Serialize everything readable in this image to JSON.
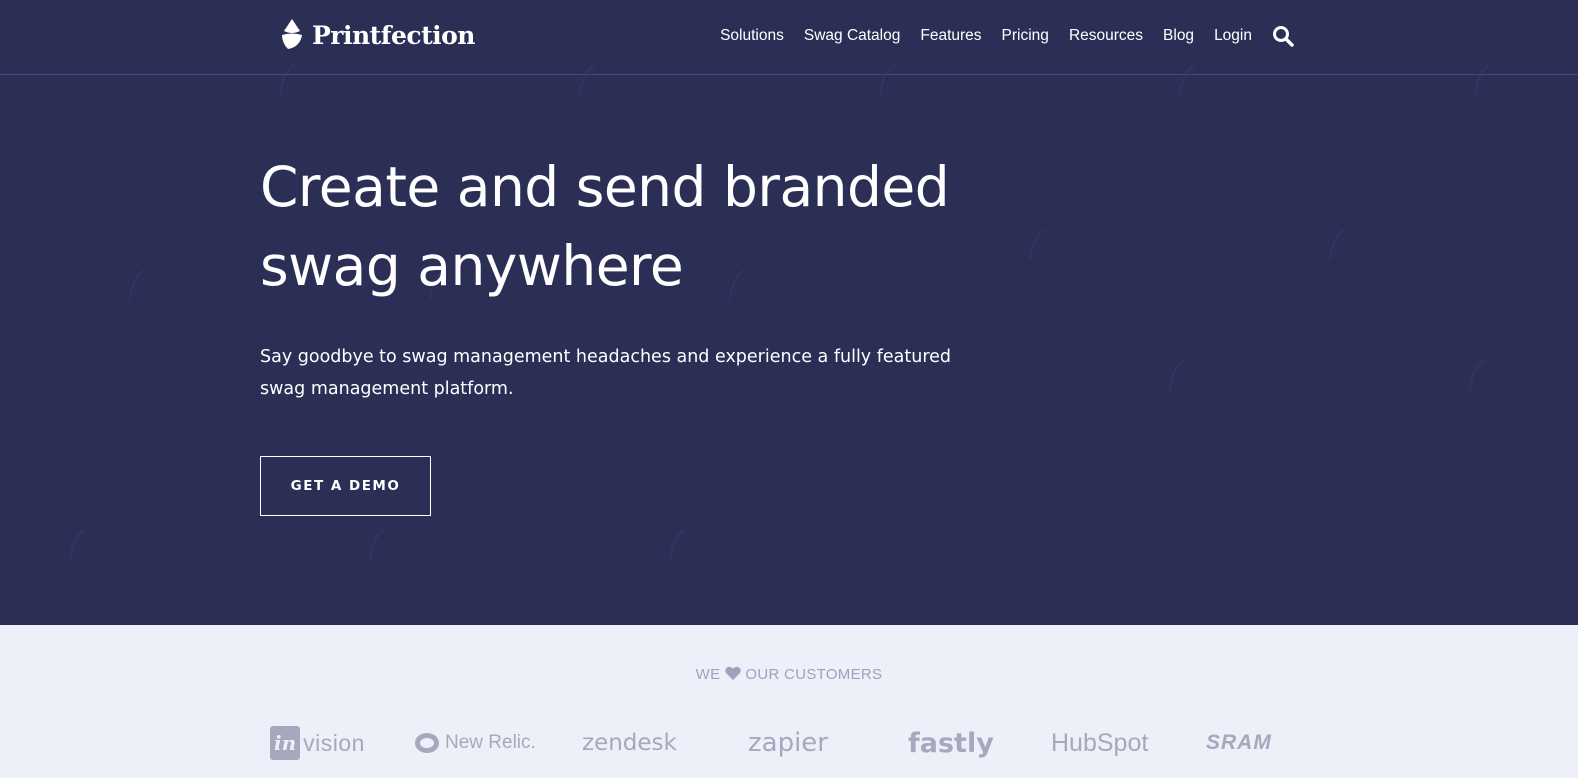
{
  "brand": {
    "name": "Printfection"
  },
  "nav": {
    "items": [
      "Solutions",
      "Swag Catalog",
      "Features",
      "Pricing",
      "Resources",
      "Blog",
      "Login"
    ],
    "search_icon": "search-icon"
  },
  "hero": {
    "headline_line1": "Create and send branded",
    "headline_line2": "swag anywhere",
    "subtext": "Say goodbye to swag management headaches and experience a fully featured swag management platform.",
    "cta_label": "GET A DEMO"
  },
  "customers": {
    "title_before": "WE",
    "title_after": "OUR CUSTOMERS",
    "heart_icon": "heart-icon",
    "logos": {
      "invision_in": "in",
      "invision_rest": "vision",
      "newrelic": "New Relic.",
      "zendesk": "zendesk",
      "zapier": "zapier",
      "fastly": "fastly",
      "hubspot": "HubSpot",
      "sram": "SRAM"
    }
  },
  "colors": {
    "hero_bg": "#2b2f56",
    "customers_bg": "#edf0f8",
    "logo_gray": "#a6a9be",
    "text_white": "#ffffff"
  }
}
